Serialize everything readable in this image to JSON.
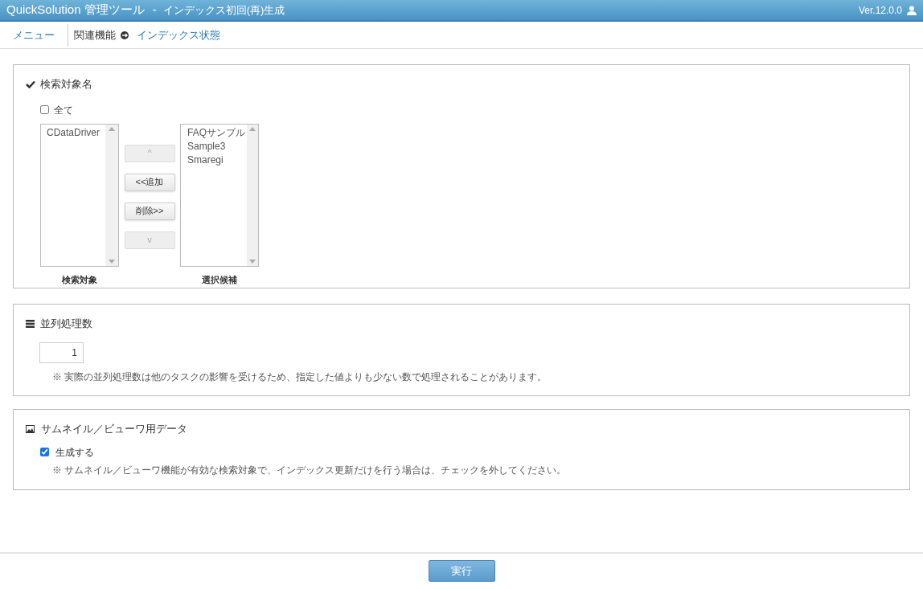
{
  "header": {
    "title": "QuickSolution 管理ツール",
    "separator": "-",
    "subtitle": "インデックス初回(再)生成",
    "version": "Ver.12.0.0"
  },
  "nav": {
    "menu": "メニュー",
    "related_label": "関連機能",
    "related_link": "インデックス状態"
  },
  "target_section": {
    "title": "検索対象名",
    "all_checkbox": {
      "label": "全て",
      "checked": false
    },
    "selected_list": {
      "label": "検索対象",
      "items": [
        "CDataDriver"
      ]
    },
    "buttons": [
      {
        "label": "^",
        "disabled": true
      },
      {
        "label": "<<追加",
        "disabled": false
      },
      {
        "label": "削除>>",
        "disabled": false
      },
      {
        "label": "v",
        "disabled": true
      }
    ],
    "candidate_list": {
      "label": "選択候補",
      "items": [
        "FAQサンプル",
        "Sample3",
        "Smaregi"
      ]
    }
  },
  "parallel_section": {
    "title": "並列処理数",
    "value": "1",
    "note": "※ 実際の並列処理数は他のタスクの影響を受けるため、指定した値よりも少ない数で処理されることがあります。"
  },
  "thumbnail_section": {
    "title": "サムネイル／ビューワ用データ",
    "checkbox": {
      "label": "生成する",
      "checked": true
    },
    "note": "※ サムネイル／ビューワ機能が有効な検索対象で、インデックス更新だけを行う場合は、チェックを外してください。"
  },
  "footer": {
    "run_button": "実行"
  }
}
